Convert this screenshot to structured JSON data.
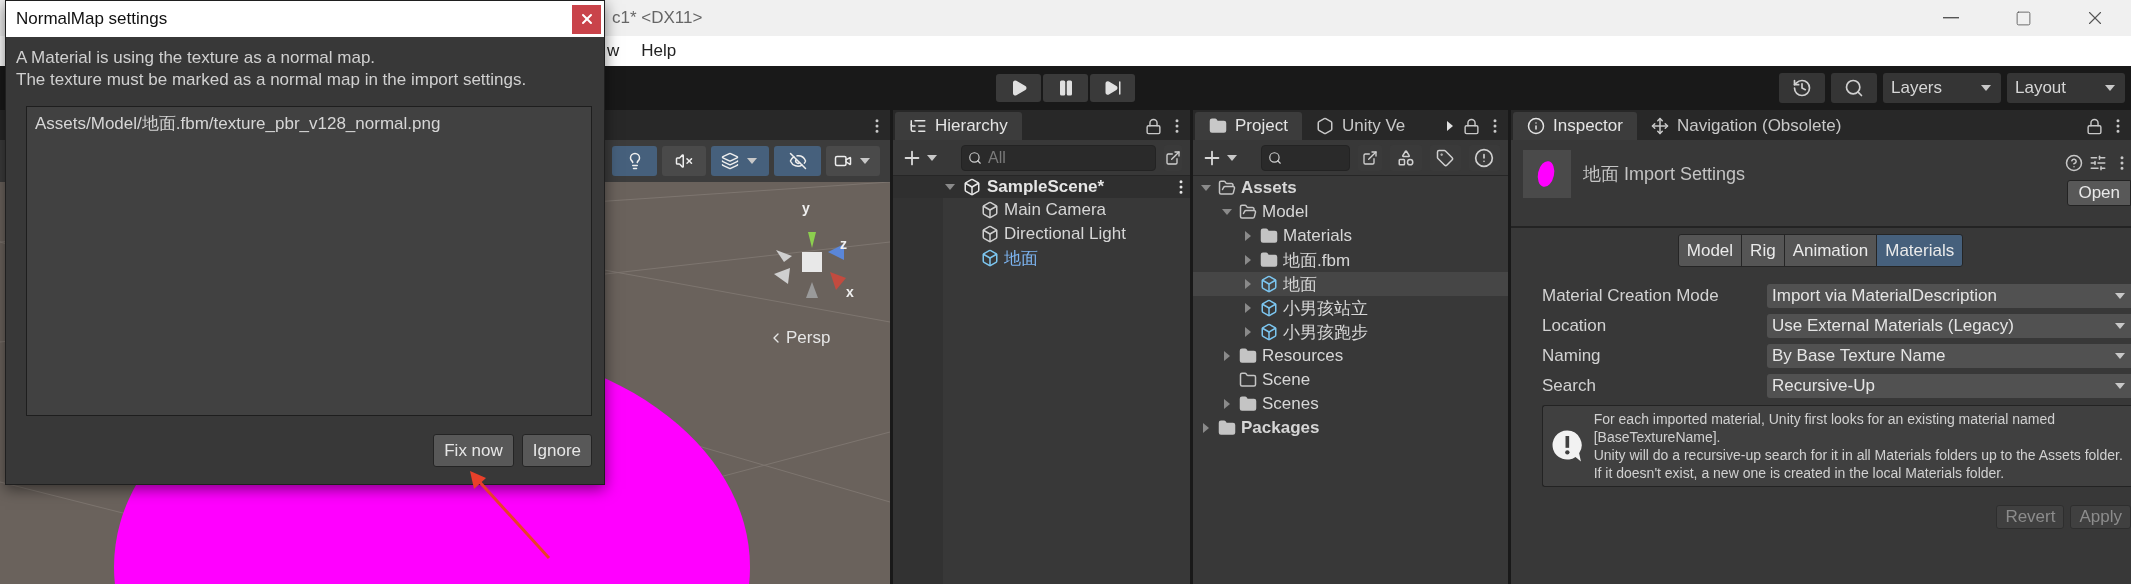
{
  "app_window": {
    "title": "c1* <DX11>",
    "menu": [
      "w",
      "Help"
    ]
  },
  "toolbar": {
    "layers": "Layers",
    "layout": "Layout"
  },
  "scene_view": {
    "tools": [
      {
        "kind": "light",
        "on": true
      },
      {
        "kind": "audio",
        "on": false
      },
      {
        "kind": "effects",
        "on": true
      },
      {
        "kind": "visibility",
        "on": true
      },
      {
        "kind": "camera",
        "on": false
      }
    ],
    "gizmo_labels": {
      "y": "y",
      "z": "z",
      "x": "x"
    },
    "projection": "Persp"
  },
  "dialog": {
    "title": "NormalMap settings",
    "message": [
      "A Material is using the texture as a normal map.",
      "The texture must be marked as a normal map in the import settings."
    ],
    "assets": [
      "Assets/Model/地面.fbm/texture_pbr_v128_normal.png"
    ],
    "buttons": [
      "Fix now",
      "Ignore"
    ]
  },
  "hierarchy": {
    "tab": "Hierarchy",
    "search_placeholder": "All",
    "scene": {
      "name": "SampleScene*",
      "expanded": true,
      "children": [
        {
          "name": "Main Camera",
          "kind": "object"
        },
        {
          "name": "Directional Light",
          "kind": "object"
        },
        {
          "name": "地面",
          "kind": "prefab"
        }
      ]
    }
  },
  "project": {
    "tabs": [
      {
        "label": "Project",
        "kind": "folder",
        "selected": true
      },
      {
        "label": "Unity Ve",
        "kind": "version-control",
        "selected": false
      }
    ],
    "tree": [
      {
        "name": "Assets",
        "kind": "folder",
        "expanded": true,
        "selected": false,
        "children": [
          {
            "name": "Model",
            "kind": "folder",
            "expanded": true,
            "selected": false,
            "children": [
              {
                "name": "Materials",
                "kind": "folder",
                "expanded": false,
                "selected": false
              },
              {
                "name": "地面.fbm",
                "kind": "folder",
                "expanded": false,
                "selected": false
              },
              {
                "name": "地面",
                "kind": "model",
                "expanded": false,
                "selected": true
              },
              {
                "name": "小男孩站立",
                "kind": "model",
                "expanded": false,
                "selected": false
              },
              {
                "name": "小男孩跑步",
                "kind": "model",
                "expanded": false,
                "selected": false
              }
            ]
          },
          {
            "name": "Resources",
            "kind": "folder",
            "expanded": false,
            "selected": false
          },
          {
            "name": "Scene",
            "kind": "empty-folder",
            "selected": false
          },
          {
            "name": "Scenes",
            "kind": "folder",
            "expanded": false,
            "selected": false
          }
        ]
      },
      {
        "name": "Packages",
        "kind": "folder",
        "expanded": false,
        "selected": false
      }
    ]
  },
  "inspector": {
    "tabs": [
      {
        "label": "Inspector",
        "kind": "info",
        "selected": true
      },
      {
        "label": "Navigation (Obsolete)",
        "kind": "navigation",
        "selected": false
      }
    ],
    "title": "地面 Import Settings",
    "open_button": "Open",
    "mode_tabs": [
      {
        "label": "Model",
        "selected": false
      },
      {
        "label": "Rig",
        "selected": false
      },
      {
        "label": "Animation",
        "selected": false
      },
      {
        "label": "Materials",
        "selected": true
      }
    ],
    "fields": [
      {
        "label": "Material Creation Mode",
        "value": "Import via MaterialDescription"
      },
      {
        "label": "Location",
        "value": "Use External Materials (Legacy)"
      },
      {
        "label": "Naming",
        "value": "By Base Texture Name"
      },
      {
        "label": "Search",
        "value": "Recursive-Up"
      }
    ],
    "help": [
      "For each imported material, Unity first looks for an existing material named [BaseTextureName].",
      "Unity will do a recursive-up search for it in all Materials folders up to the Assets folder.",
      "If it doesn't exist, a new one is created in the local Materials folder."
    ],
    "buttons": [
      {
        "label": "Revert",
        "disabled": true
      },
      {
        "label": "Apply",
        "disabled": true
      }
    ]
  }
}
